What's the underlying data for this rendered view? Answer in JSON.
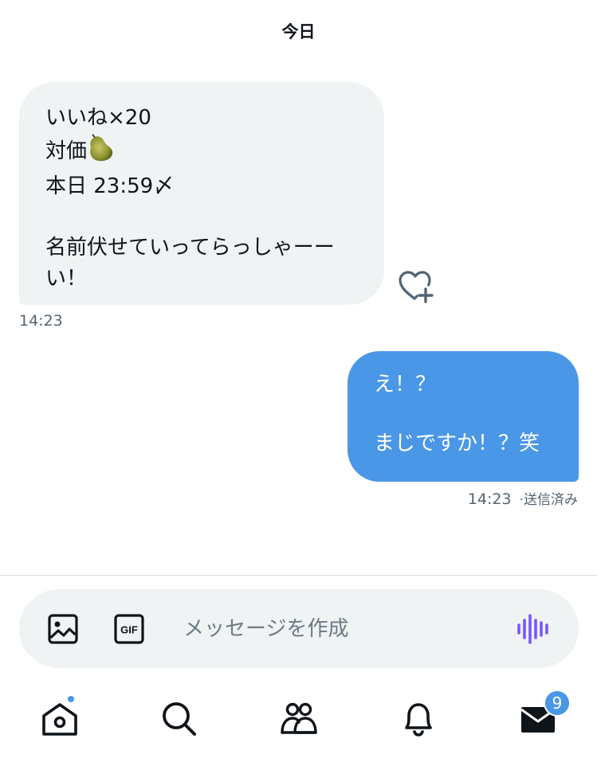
{
  "conversation": {
    "date_header": "今日",
    "incoming": {
      "lines": [
        "いいね×20",
        "対価",
        "本日 23:59〆",
        "",
        "名前伏せていってらっしゃーー",
        "い！"
      ],
      "emoji_icon": "pear-emoji",
      "time": "14:23"
    },
    "outgoing": {
      "lines": [
        "え！？",
        "",
        "まじですか！？笑"
      ],
      "time": "14:23",
      "status": "·送信済み"
    }
  },
  "composer": {
    "placeholder": "メッセージを作成",
    "gif_label": "GIF"
  },
  "tabbar": {
    "messages_badge": "9"
  },
  "colors": {
    "accent": "#4a97e7",
    "incoming_bubble": "#eff3f4",
    "voice_icon": "#7856ff",
    "secondary_text": "#536471"
  }
}
